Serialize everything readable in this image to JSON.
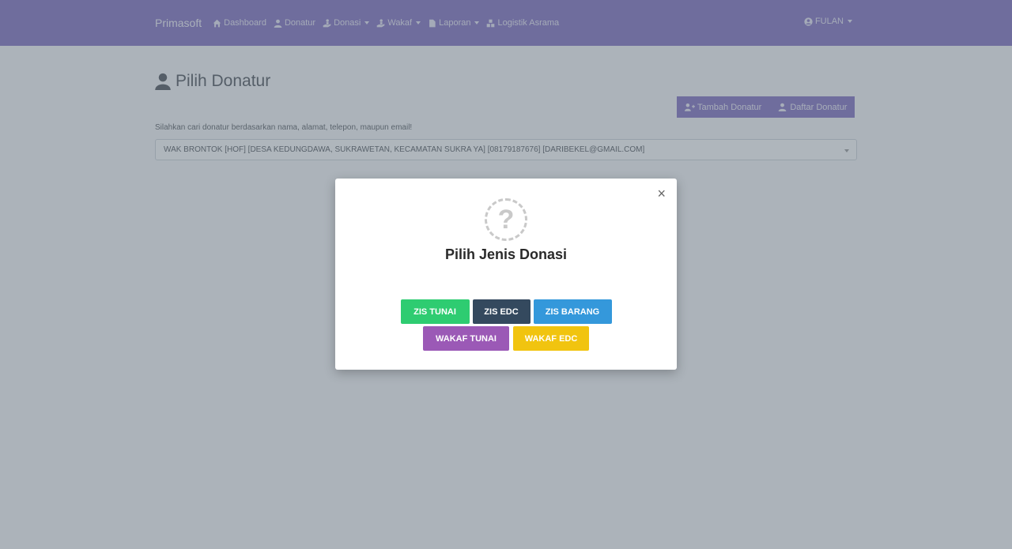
{
  "navbar": {
    "brand": "Primasoft",
    "items": [
      {
        "label": "Dashboard",
        "icon": "home-icon",
        "dropdown": false
      },
      {
        "label": "Donatur",
        "icon": "user-icon",
        "dropdown": false
      },
      {
        "label": "Donasi",
        "icon": "hand-holding-icon",
        "dropdown": true
      },
      {
        "label": "Wakaf",
        "icon": "hand-holding-icon",
        "dropdown": true
      },
      {
        "label": "Laporan",
        "icon": "file-icon",
        "dropdown": true
      },
      {
        "label": "Logistik Asrama",
        "icon": "boxes-icon",
        "dropdown": false
      }
    ],
    "user": "FULAN"
  },
  "page": {
    "title": "Pilih Donatur",
    "buttons": {
      "add": "Tambah Donatur",
      "list": "Daftar Donatur"
    },
    "help_text": "Silahkan cari donatur berdasarkan nama, alamat, telepon, maupun email!",
    "select_value": "WAK BRONTOK [HOF] [DESA KEDUNGDAWA, SUKRAWETAN, KECAMATAN SUKRA YA] [08179187676] [DARIBEKEL@GMAIL.COM]"
  },
  "modal": {
    "close": "×",
    "icon_glyph": "?",
    "title": "Pilih Jenis Donasi",
    "buttons": [
      {
        "label": "ZIS TUNAI",
        "color": "#2ecc71"
      },
      {
        "label": "ZIS EDC",
        "color": "#34495e"
      },
      {
        "label": "ZIS BARANG",
        "color": "#3498db"
      },
      {
        "label": "WAKAF TUNAI",
        "color": "#9b59b6"
      },
      {
        "label": "WAKAF EDC",
        "color": "#f1c40f"
      }
    ]
  },
  "colors": {
    "navbar": "#7e6cc0",
    "overlay": "rgba(96,110,122,0.5)"
  }
}
